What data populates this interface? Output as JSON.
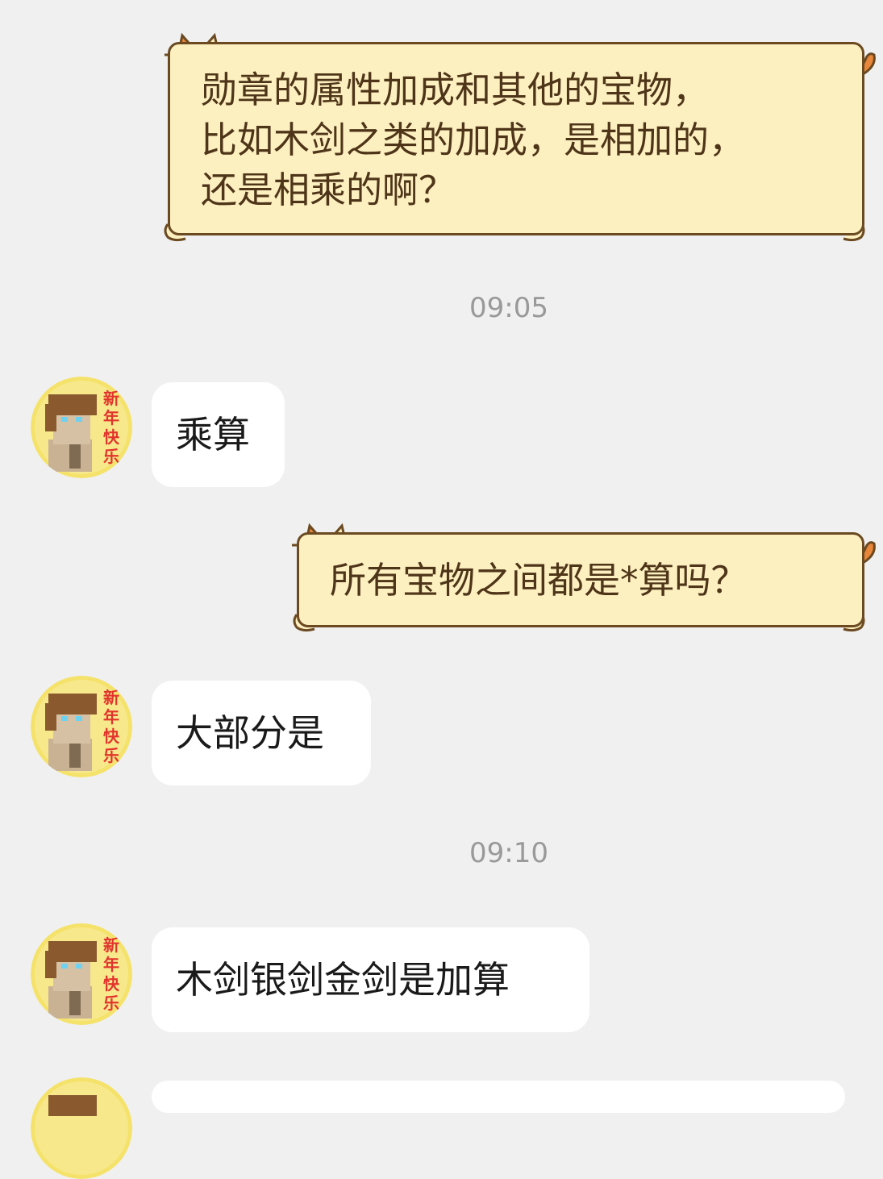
{
  "messages": [
    {
      "type": "sent",
      "text": "勋章的属性加成和其他的宝物，\n比如木剑之类的加成，是相加的，\n还是相乘的啊？"
    },
    {
      "type": "timestamp",
      "text": "09:05"
    },
    {
      "type": "received",
      "text": "乘算"
    },
    {
      "type": "sent",
      "text": "所有宝物之间都是*算吗？"
    },
    {
      "type": "received",
      "text": "大部分是"
    },
    {
      "type": "timestamp",
      "text": "09:10"
    },
    {
      "type": "received",
      "text": "木剑银剑金剑是加算"
    }
  ],
  "avatar": {
    "badge_text": [
      "新",
      "年",
      "快",
      "乐"
    ],
    "badge_color": "#e2342c",
    "background_color": "#f5e26a"
  },
  "colors": {
    "sent_bubble_fill": "#fdf0c0",
    "sent_bubble_border": "#6b4a22",
    "cat_orange": "#e8863a",
    "received_bubble_fill": "#ffffff",
    "chat_background": "#f0f0f0"
  }
}
